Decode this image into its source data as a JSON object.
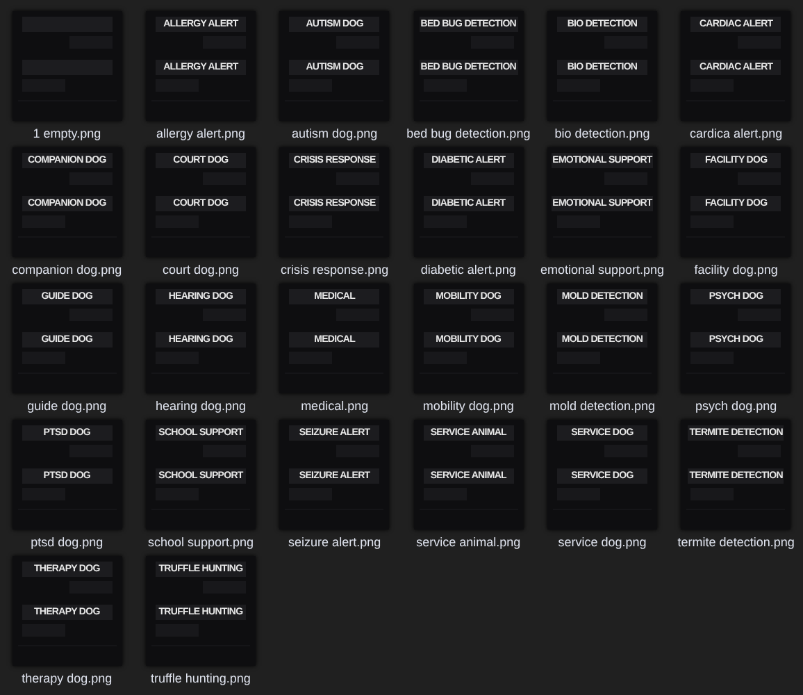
{
  "files": [
    {
      "name": "1 empty.png"
    },
    {
      "name": "allergy alert.png",
      "lines": [
        "ALLERGY ALERT",
        "ALLERGY ALERT"
      ]
    },
    {
      "name": "autism dog.png",
      "lines": [
        "AUTISM DOG",
        "AUTISM DOG"
      ]
    },
    {
      "name": "bed bug detection.png",
      "lines": [
        "BED BUG DETECTION",
        "BED BUG DETECTION"
      ]
    },
    {
      "name": "bio detection.png",
      "lines": [
        "BIO DETECTION",
        "BIO DETECTION"
      ]
    },
    {
      "name": "cardica alert.png",
      "lines": [
        "CARDIAC ALERT",
        "CARDIAC ALERT"
      ]
    },
    {
      "name": "companion dog.png",
      "lines": [
        "COMPANION DOG",
        "COMPANION DOG"
      ]
    },
    {
      "name": "court dog.png",
      "lines": [
        "COURT DOG",
        "COURT DOG"
      ]
    },
    {
      "name": "crisis response.png",
      "lines": [
        "CRISIS RESPONSE",
        "CRISIS RESPONSE"
      ]
    },
    {
      "name": "diabetic alert.png",
      "lines": [
        "DIABETIC ALERT",
        "DIABETIC ALERT"
      ]
    },
    {
      "name": "emotional support.png",
      "lines": [
        "EMOTIONAL SUPPORT",
        "EMOTIONAL SUPPORT"
      ]
    },
    {
      "name": "facility dog.png",
      "lines": [
        "FACILITY DOG",
        "FACILITY DOG"
      ]
    },
    {
      "name": "guide dog.png",
      "lines": [
        "GUIDE DOG",
        "GUIDE DOG"
      ]
    },
    {
      "name": "hearing dog.png",
      "lines": [
        "HEARING DOG",
        "HEARING DOG"
      ]
    },
    {
      "name": "medical.png",
      "lines": [
        "MEDICAL",
        "MEDICAL"
      ]
    },
    {
      "name": "mobility dog.png",
      "lines": [
        "MOBILITY DOG",
        "MOBILITY DOG"
      ]
    },
    {
      "name": "mold detection.png",
      "lines": [
        "MOLD DETECTION",
        "MOLD DETECTION"
      ]
    },
    {
      "name": "psych dog.png",
      "lines": [
        "PSYCH DOG",
        "PSYCH DOG"
      ]
    },
    {
      "name": "ptsd dog.png",
      "lines": [
        "PTSD DOG",
        "PTSD DOG"
      ]
    },
    {
      "name": "school support.png",
      "lines": [
        "SCHOOL SUPPORT",
        "SCHOOL SUPPORT"
      ]
    },
    {
      "name": "seizure alert.png",
      "lines": [
        "SEIZURE ALERT",
        "SEIZURE ALERT"
      ]
    },
    {
      "name": "service animal.png",
      "lines": [
        "SERVICE ANIMAL",
        "SERVICE ANIMAL"
      ]
    },
    {
      "name": "service dog.png",
      "lines": [
        "SERVICE DOG",
        "SERVICE DOG"
      ]
    },
    {
      "name": "termite detection.png",
      "lines": [
        "TERMITE DETECTION",
        "TERMITE DETECTION"
      ]
    },
    {
      "name": "therapy dog.png",
      "lines": [
        "THERAPY DOG",
        "THERAPY DOG"
      ]
    },
    {
      "name": "truffle hunting.png",
      "lines": [
        "TRUFFLE HUNTING",
        "TRUFFLE HUNTING"
      ]
    }
  ]
}
